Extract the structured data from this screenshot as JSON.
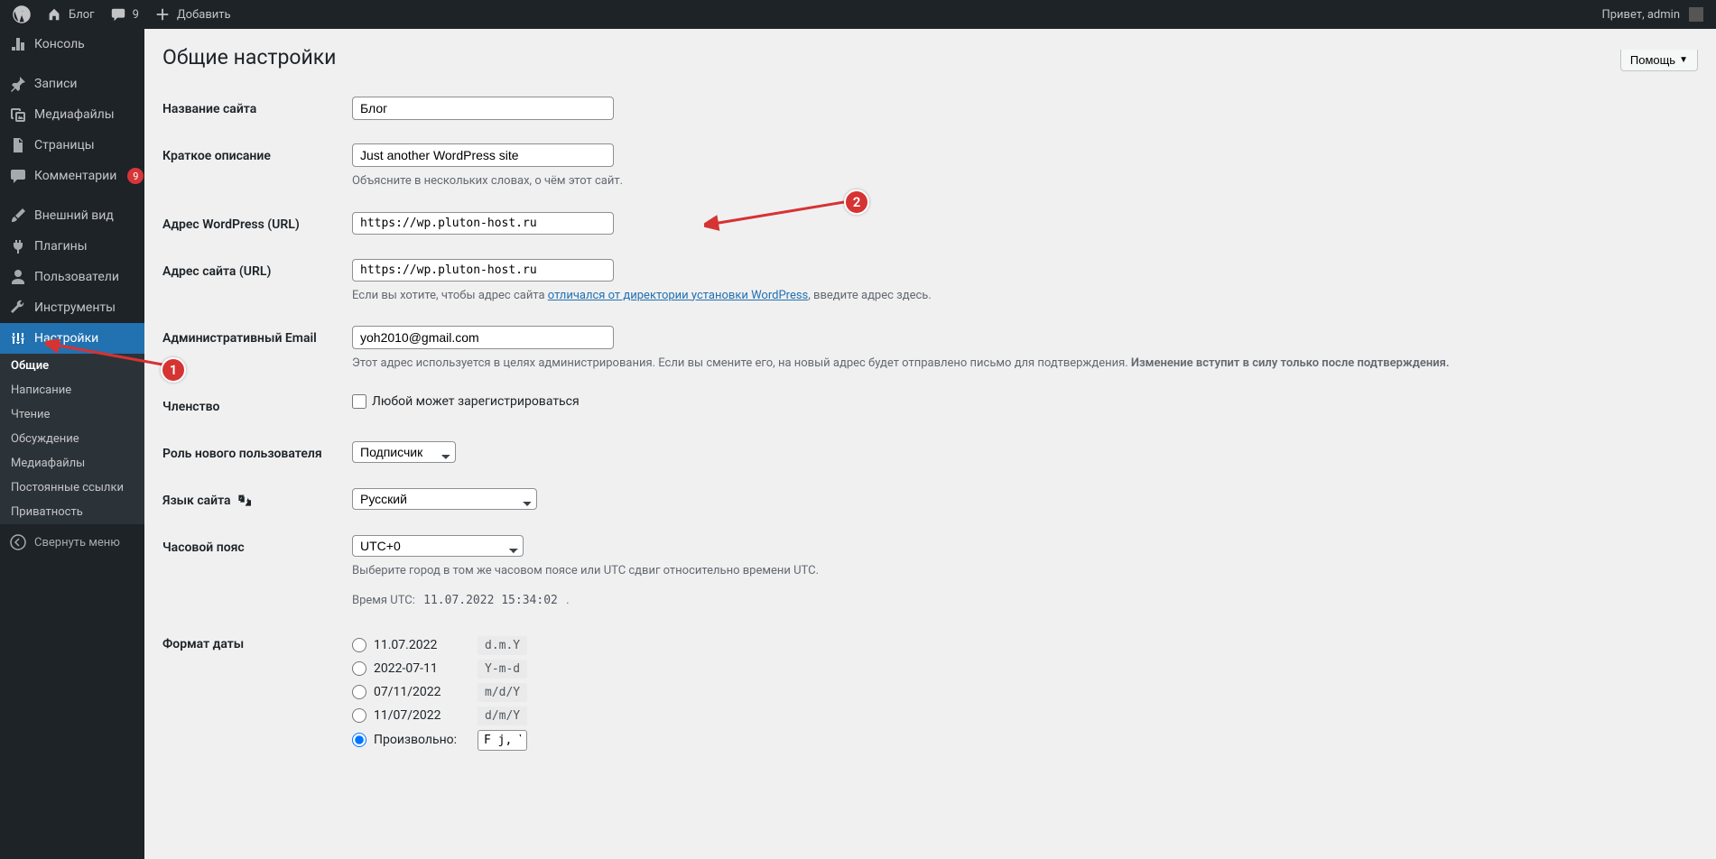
{
  "topbar": {
    "site": "Блог",
    "comments_count": "9",
    "add_new": "Добавить",
    "greeting": "Привет, admin"
  },
  "sidebar": {
    "console": "Консоль",
    "posts": "Записи",
    "media": "Медиафайлы",
    "pages": "Страницы",
    "comments": "Комментарии",
    "comments_badge": "9",
    "appearance": "Внешний вид",
    "plugins": "Плагины",
    "users": "Пользователи",
    "tools": "Инструменты",
    "settings": "Настройки",
    "submenu": {
      "general": "Общие",
      "writing": "Написание",
      "reading": "Чтение",
      "discussion": "Обсуждение",
      "media": "Медиафайлы",
      "permalinks": "Постоянные ссылки",
      "privacy": "Приватность"
    },
    "collapse": "Свернуть меню"
  },
  "page": {
    "help_label": "Помощь",
    "title": "Общие настройки",
    "site_title_label": "Название сайта",
    "site_title_value": "Блог",
    "tagline_label": "Краткое описание",
    "tagline_value": "Just another WordPress site",
    "tagline_desc": "Объясните в нескольких словах, о чём этот сайт.",
    "wp_url_label": "Адрес WordPress (URL)",
    "wp_url_value": "https://wp.pluton-host.ru",
    "site_url_label": "Адрес сайта (URL)",
    "site_url_value": "https://wp.pluton-host.ru",
    "site_url_desc_1": "Если вы хотите, чтобы адрес сайта ",
    "site_url_desc_link": "отличался от директории установки WordPress",
    "site_url_desc_2": ", введите адрес здесь.",
    "admin_email_label": "Административный Email",
    "admin_email_value": "yoh2010@gmail.com",
    "admin_email_desc_1": "Этот адрес используется в целях администрирования. Если вы смените его, на новый адрес будет отправлено письмо для подтверждения. ",
    "admin_email_desc_2": "Изменение вступит в силу только после подтверждения.",
    "membership_label": "Членство",
    "membership_check": "Любой может зарегистрироваться",
    "role_label": "Роль нового пользователя",
    "role_value": "Подписчик",
    "lang_label": "Язык сайта",
    "lang_value": "Русский",
    "tz_label": "Часовой пояс",
    "tz_value": "UTC+0",
    "tz_desc": "Выберите город в том же часовом поясе или UTC сдвиг относительно времени UTC.",
    "utc_time_label": "Время UTC: ",
    "utc_time_value": "11.07.2022 15:34:02",
    "date_format_label": "Формат даты",
    "date_opt1_label": "11.07.2022",
    "date_opt1_code": "d.m.Y",
    "date_opt2_label": "2022-07-11",
    "date_opt2_code": "Y-m-d",
    "date_opt3_label": "07/11/2022",
    "date_opt3_code": "m/d/Y",
    "date_opt4_label": "11/07/2022",
    "date_opt4_code": "d/m/Y",
    "date_custom_label": "Произвольно:",
    "date_custom_code": "F j, Y"
  },
  "annotations": {
    "one": "1",
    "two": "2"
  }
}
